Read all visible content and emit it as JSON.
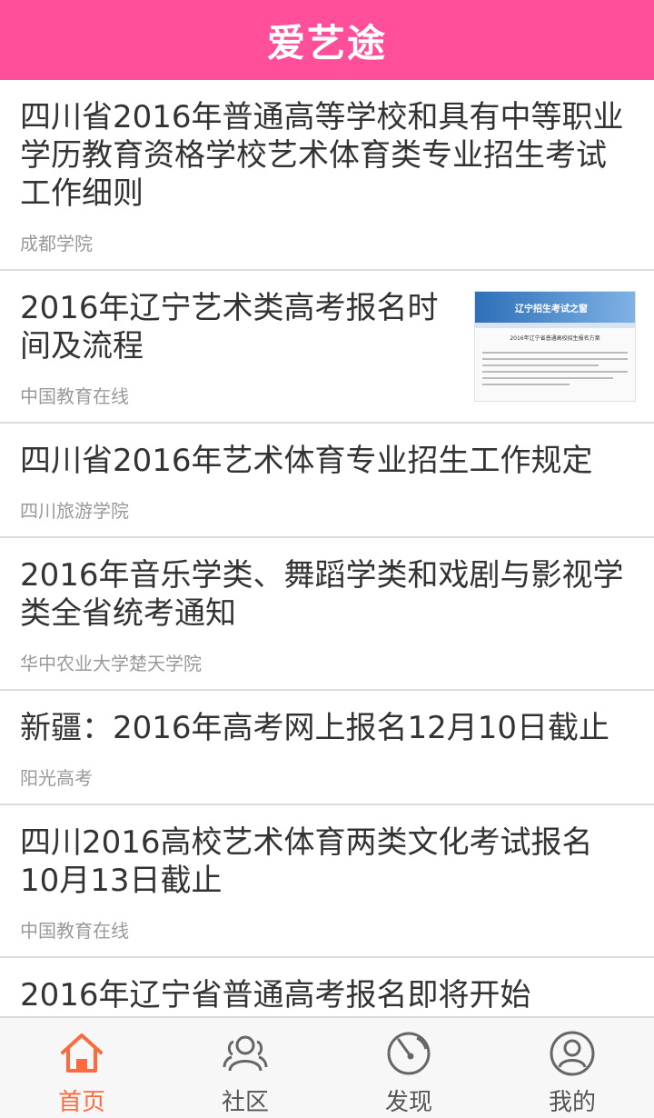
{
  "header": {
    "title": "爱艺途"
  },
  "articles": [
    {
      "title": "四川省2016年普通高等学校和具有中等职业学历教育资格学校艺术体育类专业招生考试工作细则",
      "source": "成都学院"
    },
    {
      "title": "2016年辽宁艺术类高考报名时间及流程",
      "source": "中国教育在线",
      "thumbnail": {
        "banner_text": "辽宁招生考试之窗",
        "heading": "2016年辽宁省普通高校招生报名方案"
      }
    },
    {
      "title": "四川省2016年艺术体育专业招生工作规定",
      "source": "四川旅游学院"
    },
    {
      "title": "2016年音乐学类、舞蹈学类和戏剧与影视学类全省统考通知",
      "source": "华中农业大学楚天学院"
    },
    {
      "title": "新疆：2016年高考网上报名12月10日截止",
      "source": "阳光高考"
    },
    {
      "title": "四川2016高校艺术体育两类文化考试报名10月13日截止",
      "source": "中国教育在线"
    },
    {
      "title": "2016年辽宁省普通高考报名即将开始",
      "source": ""
    }
  ],
  "tabs": [
    {
      "label": "首页",
      "icon": "home-icon",
      "active": true
    },
    {
      "label": "社区",
      "icon": "community-icon",
      "active": false
    },
    {
      "label": "发现",
      "icon": "discover-icon",
      "active": false
    },
    {
      "label": "我的",
      "icon": "profile-icon",
      "active": false
    }
  ],
  "colors": {
    "header_bg": "#ff4f9a",
    "active_tab": "#ff6a3c",
    "inactive_tab": "#555555"
  }
}
